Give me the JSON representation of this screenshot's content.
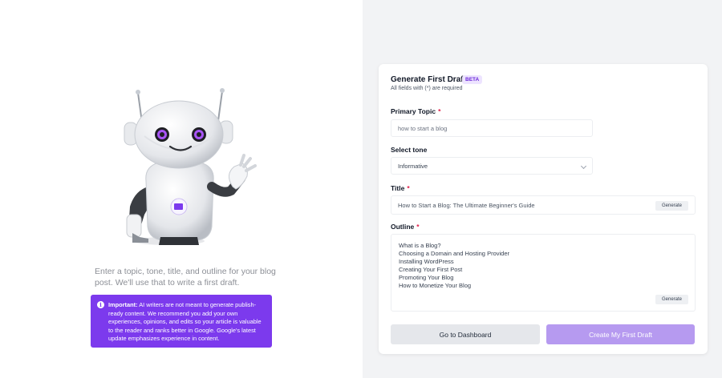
{
  "intro": {
    "line1": "Enter a topic, tone, title, and outline for your blog post.",
    "line2": "We'll use that to write a first draft."
  },
  "notice": {
    "icon": "info-icon",
    "strong": "Important:",
    "text": " AI writers are not meant to generate publish-ready content. We recommend you add your own experiences, opinions, and edits so your article is valuable to the reader and ranks better in Google. Google's latest update emphasizes experience in content."
  },
  "form": {
    "title": "Generate First Draft",
    "badge": "BETA",
    "subtitle": "All fields with (*) are required",
    "primary_topic": {
      "label": "Primary Topic",
      "required": "*",
      "value": "how to start a blog"
    },
    "tone": {
      "label": "Select tone",
      "value": "Informative"
    },
    "title_field": {
      "label": "Title",
      "required": "*",
      "value": "How to Start a Blog: The Ultimate Beginner's Guide",
      "generate_label": "Generate"
    },
    "outline": {
      "label": "Outline",
      "required": "*",
      "items": [
        "What is a Blog?",
        "Choosing a Domain and Hosting Provider",
        "Installing WordPress",
        "Creating Your First Post",
        "Promoting Your Blog",
        "How to Monetize Your Blog"
      ],
      "generate_label": "Generate"
    },
    "dashboard_label": "Go to Dashboard",
    "create_label": "Create My First Draft"
  },
  "colors": {
    "accent": "#7c3aed",
    "create_button": "#b69af0",
    "required": "#e11d48",
    "page_bg": "#f2f3f5"
  }
}
